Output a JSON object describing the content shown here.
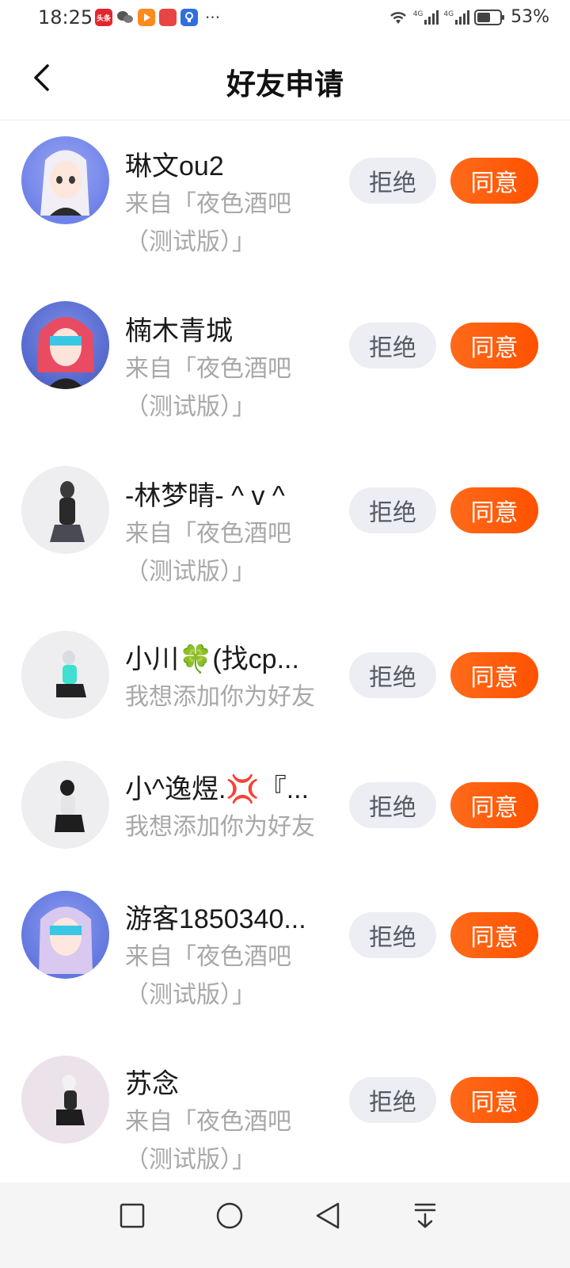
{
  "status_bar": {
    "time": "18:25",
    "battery": "53%",
    "network_1": "4G",
    "network_2": "4G",
    "app_icons": [
      "toutiao-icon",
      "wechat-icon",
      "video-icon",
      "red-app-icon",
      "blue-app-icon"
    ],
    "more": "···"
  },
  "nav": {
    "title": "好友申请"
  },
  "labels": {
    "reject": "拒绝",
    "accept": "同意"
  },
  "requests": [
    {
      "name": "琳文ou2",
      "line1": "来自「夜色酒吧",
      "line2": "（测试版）」"
    },
    {
      "name": "楠木青城",
      "line1": "来自「夜色酒吧",
      "line2": "（测试版）」"
    },
    {
      "name": "-林梦晴- ^ v ^",
      "line1": "来自「夜色酒吧",
      "line2": "（测试版）」"
    },
    {
      "name": "小川🍀(找cp...",
      "line1": "我想添加你为好友",
      "line2": ""
    },
    {
      "name": "小^逸煜.💢『...",
      "line1": "我想添加你为好友",
      "line2": ""
    },
    {
      "name": "游客1850340...",
      "line1": "来自「夜色酒吧",
      "line2": "（测试版）」"
    },
    {
      "name": "苏念",
      "line1": "来自「夜色酒吧",
      "line2": "（测试版）」"
    }
  ],
  "colors": {
    "accept": "#ff5a0a",
    "reject_bg": "#eceef3",
    "subtext": "#a8a8a8"
  }
}
